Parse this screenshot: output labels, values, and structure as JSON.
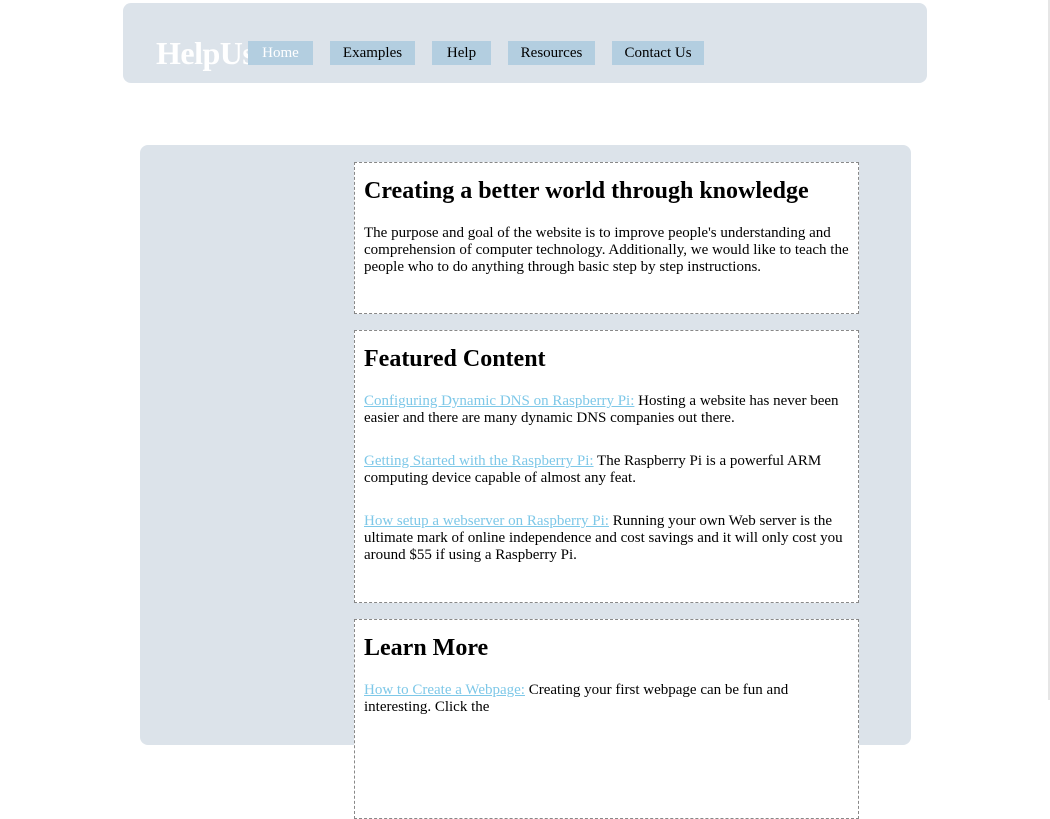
{
  "header": {
    "logo": "HelpUs",
    "nav": [
      {
        "label": "Home"
      },
      {
        "label": "Examples"
      },
      {
        "label": "Help"
      },
      {
        "label": "Resources"
      },
      {
        "label": "Contact Us"
      }
    ]
  },
  "main": {
    "intro": {
      "title": "Creating a better world through knowledge",
      "text": "The purpose and goal of the website is to improve people's understanding and comprehension of computer technology. Additionally, we would like to teach the people who to do anything through basic step by step instructions."
    },
    "featured": {
      "title": "Featured Content",
      "items": [
        {
          "link": "Configuring Dynamic DNS on Raspberry Pi:",
          "text": " Hosting a website has never been easier and there are many dynamic DNS companies out there."
        },
        {
          "link": "Getting Started with the Raspberry Pi:",
          "text": " The Raspberry Pi is a powerful ARM computing device capable of almost any feat."
        },
        {
          "link": "How setup a webserver on Raspberry Pi:",
          "text": " Running your own Web server is the ultimate mark of online independence and cost savings and it will only cost you around $55 if using a Raspberry Pi."
        }
      ]
    },
    "learn": {
      "title": "Learn More",
      "items": [
        {
          "link": "How to Create a Webpage:",
          "text": " Creating your first webpage can be fun and interesting. Click the"
        }
      ]
    }
  }
}
